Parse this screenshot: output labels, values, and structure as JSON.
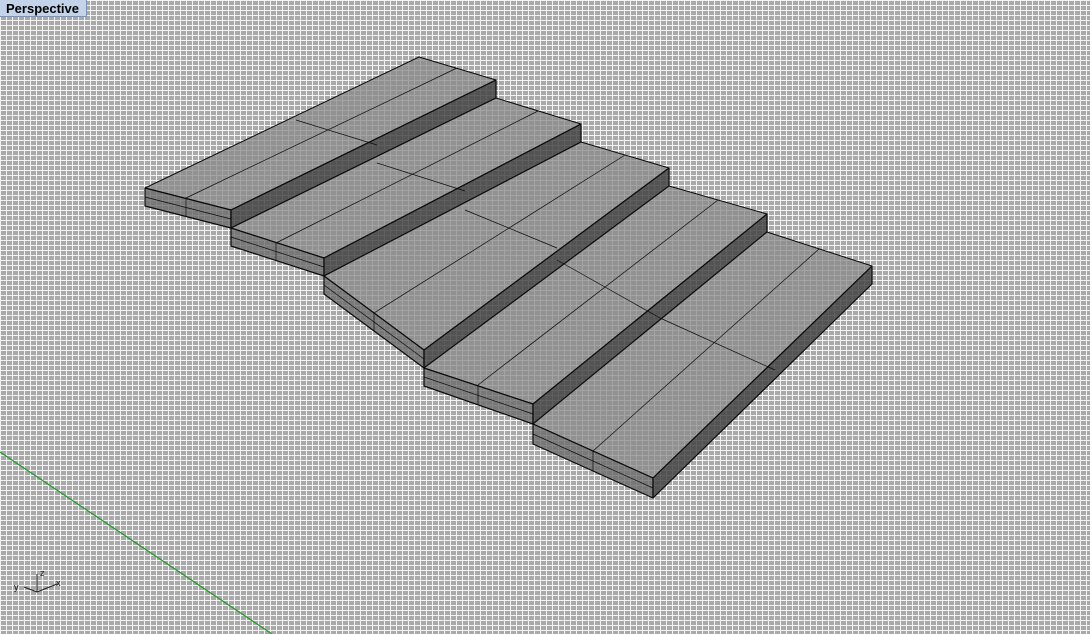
{
  "viewport": {
    "title": "Perspective",
    "view_type": "perspective",
    "display_mode": "ghosted",
    "grid": true
  },
  "axis_widget": {
    "labels": [
      "x",
      "y",
      "z"
    ]
  },
  "model": {
    "object": "stair-steps",
    "step_count": 5,
    "colors": {
      "step_fill": "#7f7f7f",
      "step_top": "#8a8a8a",
      "edge": "#0a0a0a",
      "grid_line": "#f3f3f3",
      "grid_background": "#a9a9a9",
      "y_axis_line": "#1e9a2a",
      "tab_background": "#c3d4ea"
    }
  }
}
